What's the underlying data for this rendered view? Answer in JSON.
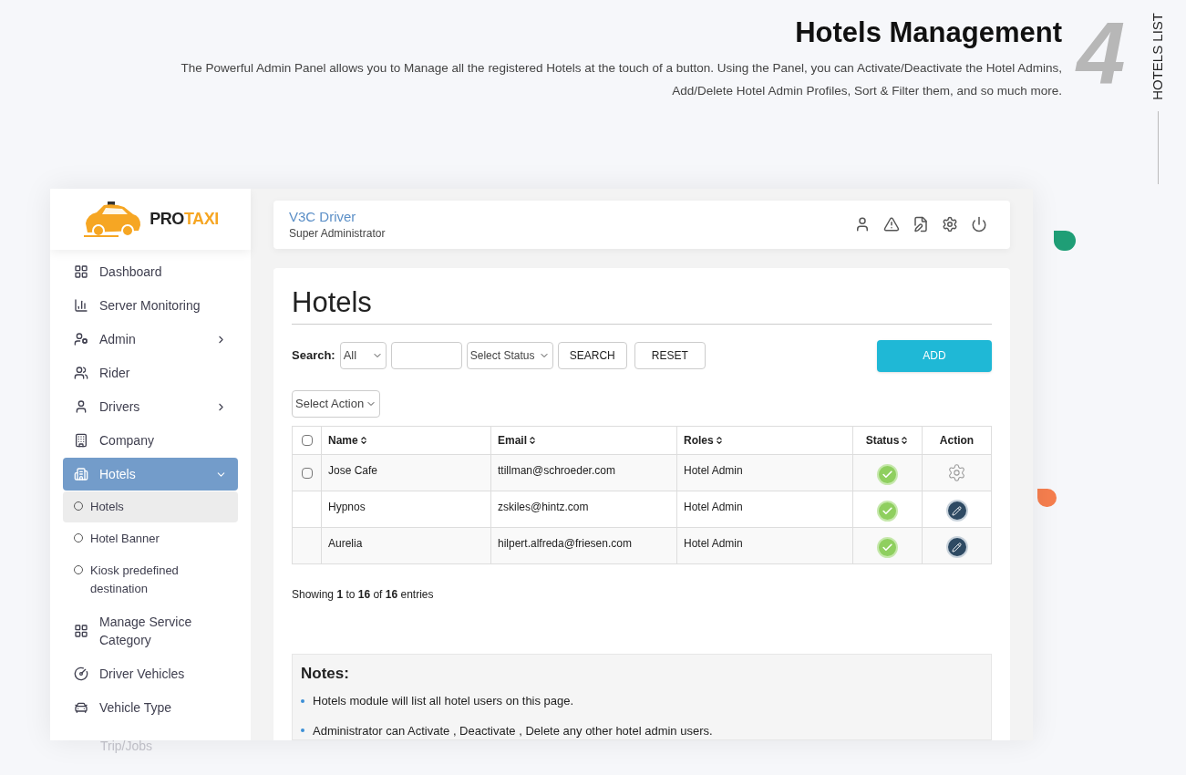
{
  "header": {
    "title": "Hotels Management",
    "description": "The Powerful Admin Panel allows you to Manage all the registered Hotels at the touch of a button. Using the Panel, you can Activate/Deactivate the Hotel Admins, Add/Delete Hotel Admin Profiles, Sort & Filter them, and so much more.",
    "number": "4",
    "side_label": "HOTELS LIST"
  },
  "logo": {
    "text_dark": "PRO",
    "text_accent": "TAXI"
  },
  "sidebar": {
    "items": [
      {
        "label": "Dashboard",
        "kind": "main",
        "selected": false,
        "has_arrow": false
      },
      {
        "label": "Server Monitoring",
        "kind": "main",
        "selected": false,
        "has_arrow": false
      },
      {
        "label": "Admin",
        "kind": "main",
        "selected": false,
        "has_arrow": true
      },
      {
        "label": "Rider",
        "kind": "main",
        "selected": false,
        "has_arrow": false
      },
      {
        "label": "Drivers",
        "kind": "main",
        "selected": false,
        "has_arrow": true
      },
      {
        "label": "Company",
        "kind": "main",
        "selected": false,
        "has_arrow": false
      },
      {
        "label": "Hotels",
        "kind": "main",
        "selected": true,
        "has_arrow": true,
        "expanded": true
      },
      {
        "label": "Hotels",
        "kind": "sub",
        "selected": true
      },
      {
        "label": "Hotel Banner",
        "kind": "sub",
        "selected": false
      },
      {
        "label": "Kiosk predefined destination",
        "kind": "sub",
        "selected": false
      },
      {
        "label": "Manage Service Category",
        "kind": "main",
        "selected": false,
        "has_arrow": false
      },
      {
        "label": "Driver Vehicles",
        "kind": "main",
        "selected": false,
        "has_arrow": false
      },
      {
        "label": "Vehicle Type",
        "kind": "main",
        "selected": false,
        "has_arrow": false
      }
    ],
    "faded_item": "Trip/Jobs"
  },
  "topbar": {
    "user_name": "V3C Driver",
    "user_role": "Super Administrator"
  },
  "content": {
    "title": "Hotels",
    "search": {
      "label": "Search:",
      "filter_value": "All",
      "status_placeholder": "Select Status",
      "search_button": "SEARCH",
      "reset_button": "RESET",
      "add_button": "ADD"
    },
    "action_select": "Select Action",
    "table": {
      "select_all_checked": false,
      "columns": [
        {
          "label": "Name",
          "sortable": true
        },
        {
          "label": "Email",
          "sortable": true
        },
        {
          "label": "Roles",
          "sortable": true
        },
        {
          "label": "Status",
          "sortable": true
        },
        {
          "label": "Action",
          "sortable": false
        }
      ],
      "rows": [
        {
          "name": "Jose Cafe",
          "email": "ttillman@schroeder.com",
          "role": "Hotel Admin",
          "active": true,
          "kind": "settings",
          "checked": false
        },
        {
          "name": "Hypnos",
          "email": "zskiles@hintz.com",
          "role": "Hotel Admin",
          "active": true,
          "kind": "edit"
        },
        {
          "name": "Aurelia",
          "email": "hilpert.alfreda@friesen.com",
          "role": "Hotel Admin",
          "active": true,
          "kind": "edit"
        }
      ]
    },
    "footer": "Showing **1** to **16** of **16** entries",
    "notes": {
      "title": "Notes:",
      "items": [
        "Hotels module will list all hotel users on this page.",
        "Administrator can Activate , Deactivate , Delete any other hotel admin users."
      ]
    }
  }
}
